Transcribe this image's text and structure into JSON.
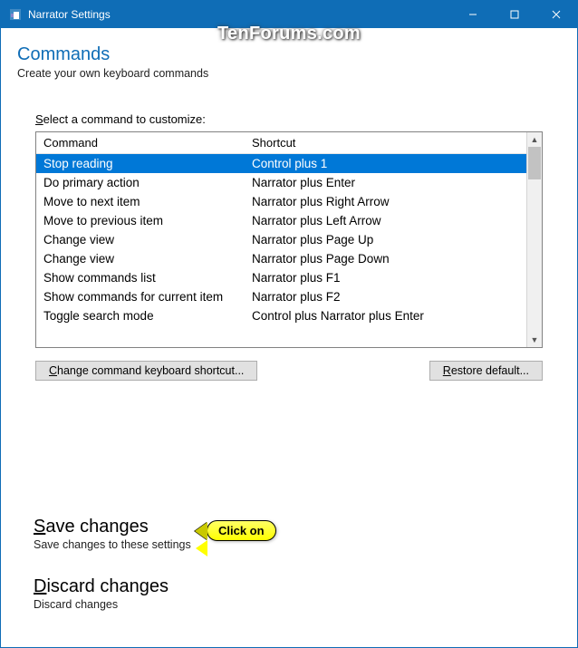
{
  "titlebar": {
    "title": "Narrator Settings"
  },
  "watermark": "TenForums.com",
  "header": {
    "title": "Commands",
    "subtitle": "Create your own keyboard commands"
  },
  "section_label_prefix": "S",
  "section_label_rest": "elect a command to customize:",
  "table": {
    "col_command": "Command",
    "col_shortcut": "Shortcut",
    "rows": [
      {
        "command": "Stop reading",
        "shortcut": "Control plus 1",
        "selected": true
      },
      {
        "command": "Do primary action",
        "shortcut": "Narrator plus Enter"
      },
      {
        "command": "Move to next item",
        "shortcut": "Narrator plus Right Arrow"
      },
      {
        "command": "Move to previous item",
        "shortcut": "Narrator plus Left Arrow"
      },
      {
        "command": "Change view",
        "shortcut": "Narrator plus Page Up"
      },
      {
        "command": "Change view",
        "shortcut": "Narrator plus Page Down"
      },
      {
        "command": "Show commands list",
        "shortcut": "Narrator plus F1"
      },
      {
        "command": "Show commands for current item",
        "shortcut": "Narrator plus F2"
      },
      {
        "command": "Toggle search mode",
        "shortcut": "Control plus Narrator plus Enter"
      }
    ]
  },
  "buttons": {
    "change_ul": "C",
    "change_rest": "hange command keyboard shortcut...",
    "restore_ul": "R",
    "restore_rest": "estore default..."
  },
  "save": {
    "title_ul": "S",
    "title_rest": "ave changes",
    "desc": "Save changes to these settings"
  },
  "discard": {
    "title_ul": "D",
    "title_rest": "iscard changes",
    "desc": "Discard changes"
  },
  "callout": "Click on"
}
